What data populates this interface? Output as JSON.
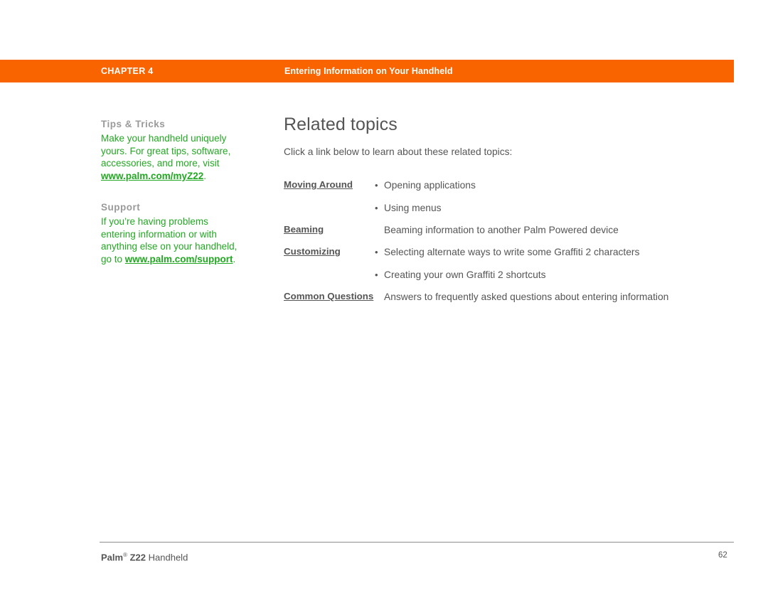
{
  "header": {
    "chapter_label": "CHAPTER 4",
    "chapter_title": "Entering Information on Your Handheld",
    "bar_color": "#FA6400"
  },
  "sidebar": {
    "blocks": [
      {
        "heading": "Tips & Tricks",
        "text_before": "Make your handheld uniquely yours. For great tips, software, accessories, and more, visit ",
        "link": "www.palm.com/myZ22",
        "text_after": "."
      },
      {
        "heading": "Support",
        "text_before": "If you’re having problems entering information or with anything else on your handheld, go to ",
        "link": "www.palm.com/support",
        "text_after": "."
      }
    ],
    "link_color": "#22A822",
    "heading_color": "#9a9a9a"
  },
  "main": {
    "title": "Related topics",
    "intro": "Click a link below to learn about these related topics:",
    "topics": [
      {
        "link": "Moving Around",
        "lines": [
          {
            "bullet": true,
            "text": "Opening applications"
          },
          {
            "bullet": true,
            "text": "Using menus"
          }
        ]
      },
      {
        "link": "Beaming",
        "lines": [
          {
            "bullet": false,
            "text": "Beaming information to another Palm Powered device"
          }
        ]
      },
      {
        "link": "Customizing",
        "lines": [
          {
            "bullet": true,
            "text": "Selecting alternate ways to write some Graffiti 2 characters"
          },
          {
            "bullet": true,
            "text": "Creating your own Graffiti 2 shortcuts"
          }
        ]
      },
      {
        "link": "Common Questions",
        "lines": [
          {
            "bullet": false,
            "text": "Answers to frequently asked questions about entering information"
          }
        ]
      }
    ],
    "bullet_glyph": "•"
  },
  "footer": {
    "brand": "Palm",
    "registered": "®",
    "model": "Z22",
    "product": "Handheld",
    "page_number": "62"
  }
}
